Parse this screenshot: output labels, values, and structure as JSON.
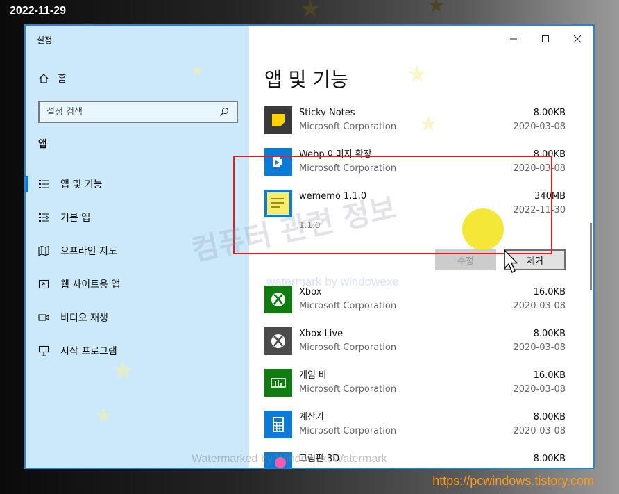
{
  "overlay": {
    "date_stamp": "2022-11-29",
    "site_url": "https://pcwindows.tistory.com",
    "watermark_korean": "컴퓨터 관련 정보",
    "watermark_small": "watermark by windowexe",
    "watermark_bottom": "Watermarked by WindowexeWatermark"
  },
  "window": {
    "title": "설정",
    "caption_buttons": [
      "minimize-icon",
      "maximize-icon",
      "close-icon"
    ]
  },
  "sidebar": {
    "home_label": "홈",
    "search_placeholder": "설정 검색",
    "section_label": "앱",
    "items": [
      {
        "label": "앱 및 기능",
        "icon": "apps-features-icon",
        "active": true
      },
      {
        "label": "기본 앱",
        "icon": "default-apps-icon",
        "active": false
      },
      {
        "label": "오프라인 지도",
        "icon": "offline-maps-icon",
        "active": false
      },
      {
        "label": "웹 사이트용 앱",
        "icon": "apps-for-websites-icon",
        "active": false
      },
      {
        "label": "비디오 재생",
        "icon": "video-playback-icon",
        "active": false
      },
      {
        "label": "시작 프로그램",
        "icon": "startup-icon",
        "active": false
      }
    ]
  },
  "main": {
    "title": "앱 및 기능",
    "apps": [
      {
        "name": "Sticky Notes",
        "publisher": "Microsoft Corporation",
        "size": "8.00KB",
        "date": "2020-03-08",
        "icon": "sticky-notes-icon"
      },
      {
        "name": "Webp 이미지 확장",
        "publisher": "Microsoft Corporation",
        "size": "8.00KB",
        "date": "2020-03-08",
        "icon": "webp-extension-icon"
      },
      {
        "name": "wememo 1.1.0",
        "publisher": "",
        "size": "340MB",
        "date": "2022-11-30",
        "version": "1.1.0",
        "icon": "wememo-icon",
        "expanded": true,
        "modify_label": "수정",
        "remove_label": "제거"
      },
      {
        "name": "Xbox",
        "publisher": "Microsoft Corporation",
        "size": "16.0KB",
        "date": "2020-03-08",
        "icon": "xbox-icon"
      },
      {
        "name": "Xbox Live",
        "publisher": "Microsoft Corporation",
        "size": "8.00KB",
        "date": "2020-03-08",
        "icon": "xbox-live-icon"
      },
      {
        "name": "게임 바",
        "publisher": "Microsoft Corporation",
        "size": "16.0KB",
        "date": "2020-03-08",
        "icon": "game-bar-icon"
      },
      {
        "name": "계산기",
        "publisher": "Microsoft Corporation",
        "size": "8.00KB",
        "date": "2020-03-08",
        "icon": "calculator-icon"
      },
      {
        "name": "그림판 3D",
        "publisher": "",
        "size": "8.00KB",
        "date": "",
        "icon": "paint-3d-icon"
      }
    ]
  },
  "colors": {
    "accent": "#0078d7",
    "sidebar_bg": "#cbe9fb",
    "highlight_border": "#e01e1e",
    "window_border": "#1f86e0"
  }
}
